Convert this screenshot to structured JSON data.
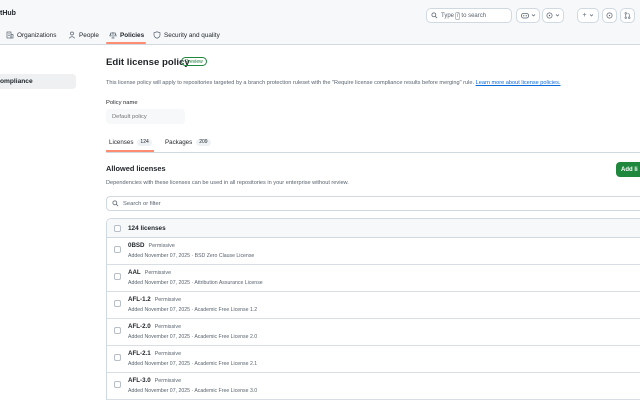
{
  "header": {
    "brand": "tHub",
    "search": {
      "prefix": "Type",
      "key": "/",
      "suffix": "to search"
    },
    "plus_label": "+"
  },
  "nav": {
    "tabs": [
      {
        "label": "Organizations",
        "icon": "org-icon"
      },
      {
        "label": "People",
        "icon": "person-icon"
      },
      {
        "label": "Policies",
        "icon": "law-icon",
        "active": true
      },
      {
        "label": "Security and quality",
        "icon": "shield-icon"
      }
    ]
  },
  "sidebar": {
    "active_item": "ompliance"
  },
  "main": {
    "title": "Edit license policy",
    "badge": "Preview",
    "description": "This license policy will apply to repositories targeted by a branch protection ruleset with the \"Require license compliance results before merging\" rule.",
    "learn_more": "Learn more about license policies.",
    "policy_name_label": "Policy name",
    "policy_name_placeholder": "Default policy",
    "tabs": [
      {
        "label": "Licenses",
        "count": "124"
      },
      {
        "label": "Packages",
        "count": "209"
      }
    ],
    "section_title": "Allowed licenses",
    "section_desc": "Dependencies with these licenses can be used in all repositories in your enterprise without review.",
    "add_button": "Add li",
    "filter_placeholder": "Search or filter",
    "list_header": "124 licenses",
    "licenses": [
      {
        "name": "0BSD",
        "type": "Permissive",
        "meta": "Added November 07, 2025 · BSD Zero Clause License"
      },
      {
        "name": "AAL",
        "type": "Permissive",
        "meta": "Added November 07, 2025 · Attribution Assurance License"
      },
      {
        "name": "AFL-1.2",
        "type": "Permissive",
        "meta": "Added November 07, 2025 · Academic Free License 1.2"
      },
      {
        "name": "AFL-2.0",
        "type": "Permissive",
        "meta": "Added November 07, 2025 · Academic Free License 2.0"
      },
      {
        "name": "AFL-2.1",
        "type": "Permissive",
        "meta": "Added November 07, 2025 · Academic Free License 2.1"
      },
      {
        "name": "AFL-3.0",
        "type": "Permissive",
        "meta": "Added November 07, 2025 · Academic Free License 3.0"
      }
    ]
  },
  "colors": {
    "accent": "#1f883d",
    "tab_underline": "#fd8c73",
    "link": "#0969da"
  }
}
